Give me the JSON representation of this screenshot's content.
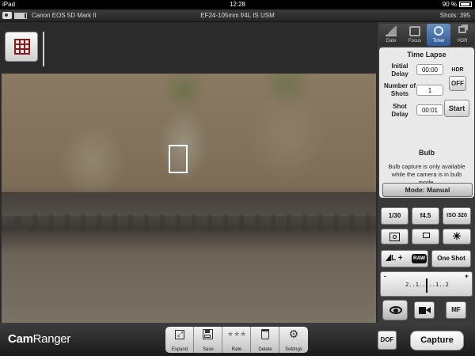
{
  "status_bar": {
    "carrier": "iPad",
    "time": "12:28",
    "battery": "90 %"
  },
  "camera_bar": {
    "camera_name": "Canon EOS 5D Mark II",
    "lens": "EF24-105mm f/4L IS USM",
    "shots": "Shots: 395"
  },
  "panel": {
    "tabs": [
      {
        "label": "Date",
        "icon": "date-icon"
      },
      {
        "label": "Focus",
        "icon": "focus-icon"
      },
      {
        "label": "Timer",
        "icon": "timer-icon",
        "active": true
      },
      {
        "label": "HDR",
        "icon": "hdr-icon"
      }
    ],
    "time_lapse": {
      "title": "Time Lapse",
      "initial_delay_label": "Initial Delay",
      "initial_delay_value": "00:00",
      "number_of_shots_label": "Number of Shots",
      "number_of_shots_value": "1",
      "shot_delay_label": "Shot Delay",
      "shot_delay_value": "00:01",
      "hdr_label": "HDR",
      "hdr_toggle": "OFF",
      "start_label": "Start"
    },
    "bulb": {
      "title": "Bulb",
      "text": "Bulb capture is only available while the camera is in bulb mode."
    },
    "mode": "Mode: Manual",
    "shutter": "1/30",
    "aperture": "f4.5",
    "iso": "ISO 320",
    "quality_icon": "L +",
    "quality_raw": "RAW",
    "drive": "One Shot",
    "ev_minus": "-",
    "ev_plus": "+",
    "ev_scale": "2..1..:..1..2",
    "af_mode": "MF"
  },
  "bottom_bar": {
    "logo_cam": "Cam",
    "logo_ranger": "Ranger",
    "tools": [
      {
        "label": "Expand",
        "icon": "expand-icon"
      },
      {
        "label": "Save",
        "icon": "save-icon"
      },
      {
        "label": "Rate",
        "icon": "rate-stars-icon"
      },
      {
        "label": "Delete",
        "icon": "trash-icon"
      },
      {
        "label": "Settings",
        "icon": "gear-icon"
      }
    ],
    "dof": "DOF",
    "capture": "Capture"
  }
}
